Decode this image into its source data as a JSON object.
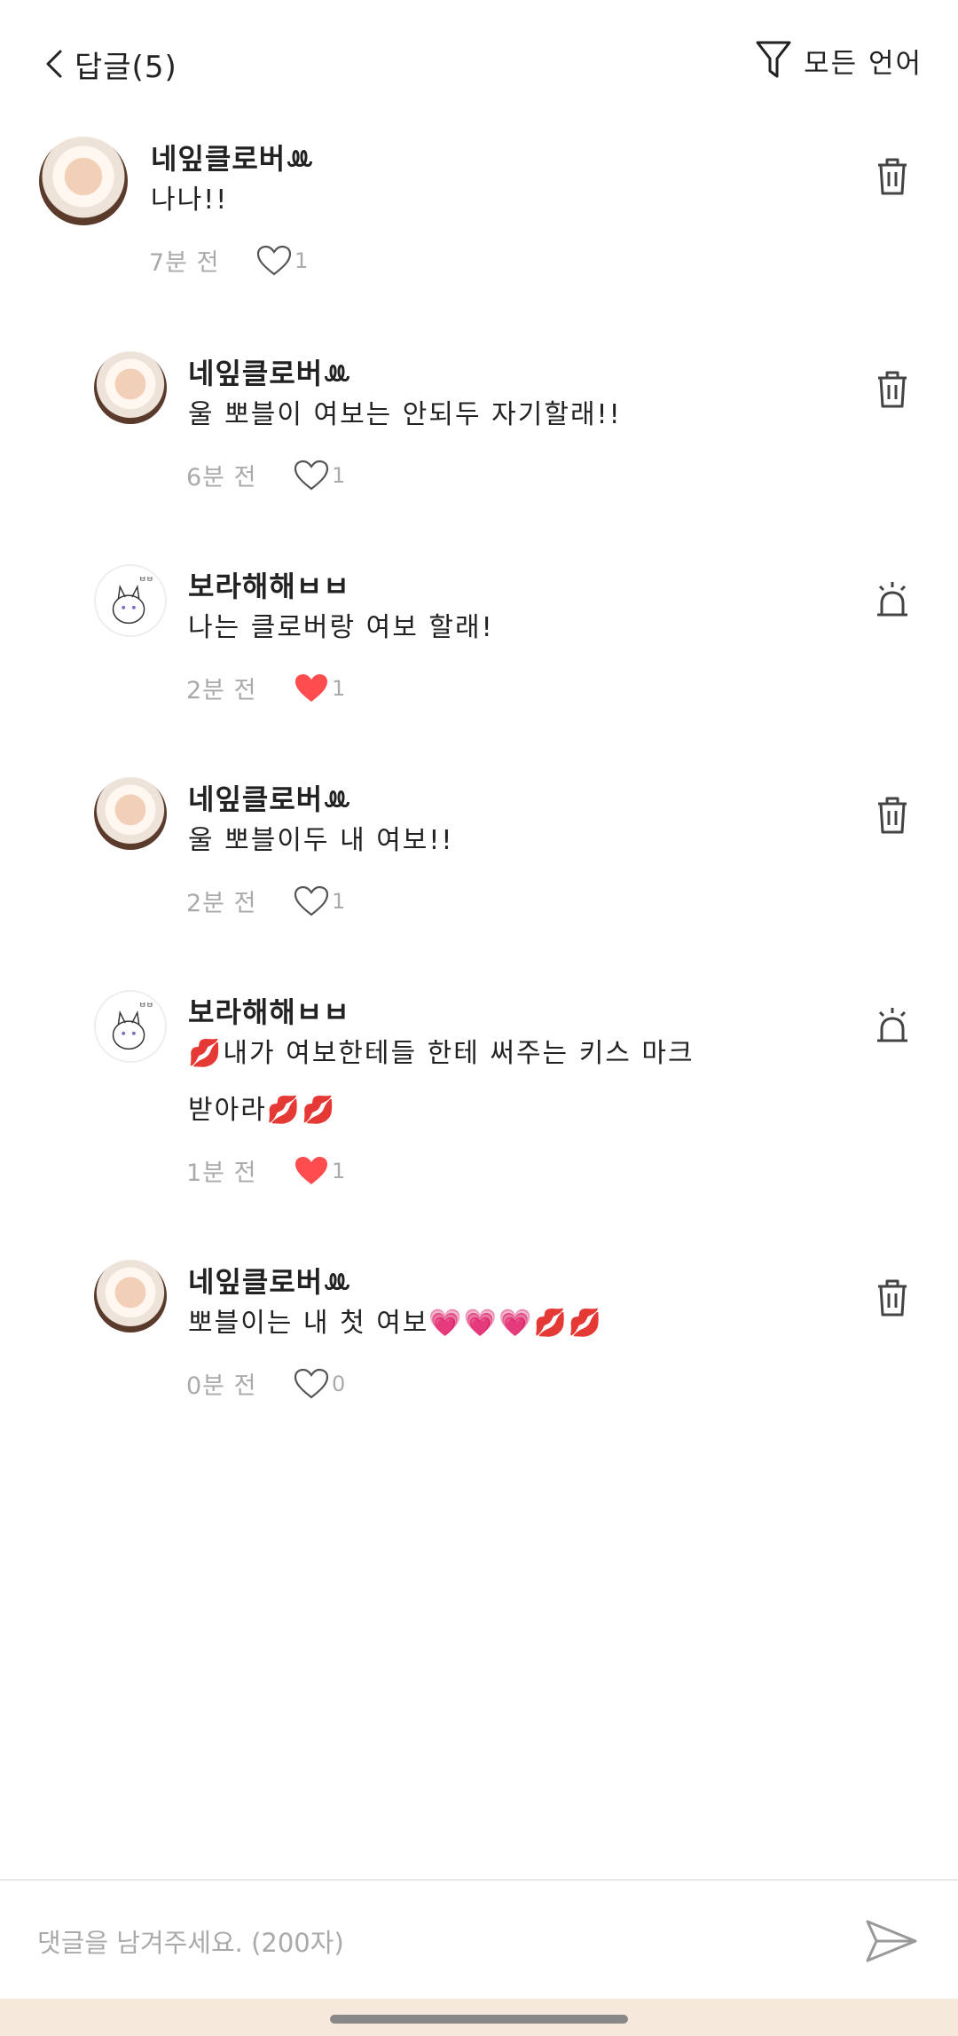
{
  "header": {
    "back_icon": "chevron-left-icon",
    "title": "답글(5)",
    "filter_icon": "filter-icon",
    "filter_label": "모든 언어"
  },
  "colors": {
    "liked_heart": "#ff4d4f",
    "muted_text": "#aaaaaa",
    "text": "#222222"
  },
  "comments": [
    {
      "name": "네잎클로버ꔛ",
      "text": "나나!!",
      "time": "7분 전",
      "likes": "1",
      "liked": false,
      "action_icon": "trash-icon",
      "avatar": "profile-photo"
    },
    {
      "name": "네잎클로버ꔛ",
      "text": "울 뽀블이 여보는 안되두 자기할래!!",
      "time": "6분 전",
      "likes": "1",
      "liked": false,
      "action_icon": "trash-icon",
      "avatar": "profile-photo"
    },
    {
      "name": "보라해해ㅂㅂ",
      "text": "나는 클로버랑 여보 할래!",
      "time": "2분 전",
      "likes": "1",
      "liked": true,
      "action_icon": "report-siren-icon",
      "avatar": "cat-drawing"
    },
    {
      "name": "네잎클로버ꔛ",
      "text": "울 뽀블이두 내 여보!!",
      "time": "2분 전",
      "likes": "1",
      "liked": false,
      "action_icon": "trash-icon",
      "avatar": "profile-photo"
    },
    {
      "name": "보라해해ㅂㅂ",
      "text_line1": "💋내가 여보한테들 한테 써주는 키스 마크",
      "text_line2": "받아라💋💋",
      "time": "1분 전",
      "likes": "1",
      "liked": true,
      "action_icon": "report-siren-icon",
      "avatar": "cat-drawing"
    },
    {
      "name": "네잎클로버ꔛ",
      "text": "뽀블이는 내 첫 여보💗💗💗💋💋",
      "time": "0분 전",
      "likes": "0",
      "liked": false,
      "action_icon": "trash-icon",
      "avatar": "profile-photo"
    }
  ],
  "input": {
    "placeholder": "댓글을 남겨주세요. (200자)",
    "send_icon": "send-icon"
  }
}
